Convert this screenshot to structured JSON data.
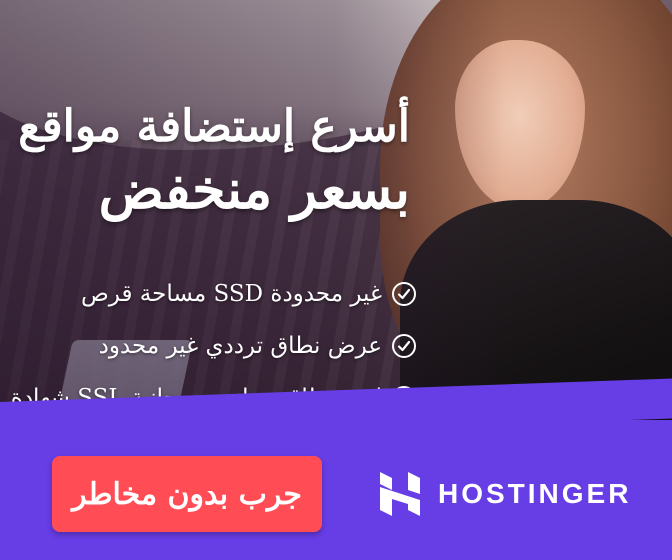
{
  "ad": {
    "headline": {
      "line1": "أسرع إستضافة مواقع",
      "line2": "بسعر منخفض"
    },
    "features": [
      {
        "text": "غير محدودة SSD مساحة قرص",
        "icon": "check-circle-icon"
      },
      {
        "text": "عرض نطاق ترددي غير محدود",
        "icon": "check-circle-icon"
      },
      {
        "text": "إسم نطاق مجاني و مجانية SSL شهادة",
        "icon": "check-circle-icon"
      }
    ],
    "cta": {
      "label": "جرب بدون مخاطر"
    },
    "brand": {
      "name": "HOSTINGER",
      "icon": "hostinger-logo-icon"
    },
    "colors": {
      "accent": "#673de6",
      "cta": "#ff4c55",
      "text": "#ffffff"
    }
  }
}
